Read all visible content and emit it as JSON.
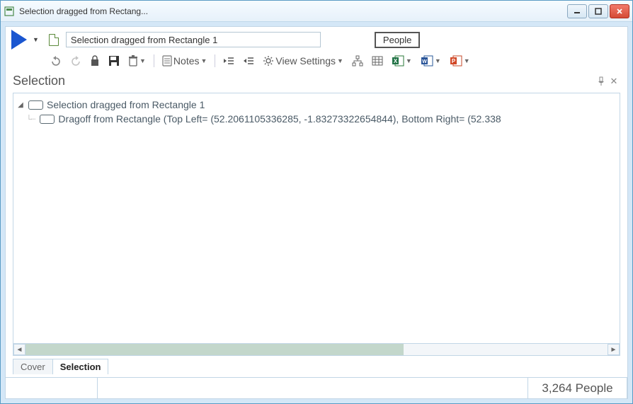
{
  "window": {
    "title": "Selection dragged from Rectang..."
  },
  "toolbar": {
    "name_input_value": "Selection dragged from Rectangle 1",
    "people_button": "People",
    "notes_label": "Notes",
    "view_settings_label": "View Settings"
  },
  "section": {
    "title": "Selection"
  },
  "tree": {
    "root_label": "Selection dragged from Rectangle 1",
    "child_label": "Dragoff from Rectangle (Top Left= (52.2061105336285, -1.83273322654844), Bottom Right= (52.338"
  },
  "tabs": {
    "cover": "Cover",
    "selection": "Selection"
  },
  "status": {
    "count": "3,264 People"
  }
}
